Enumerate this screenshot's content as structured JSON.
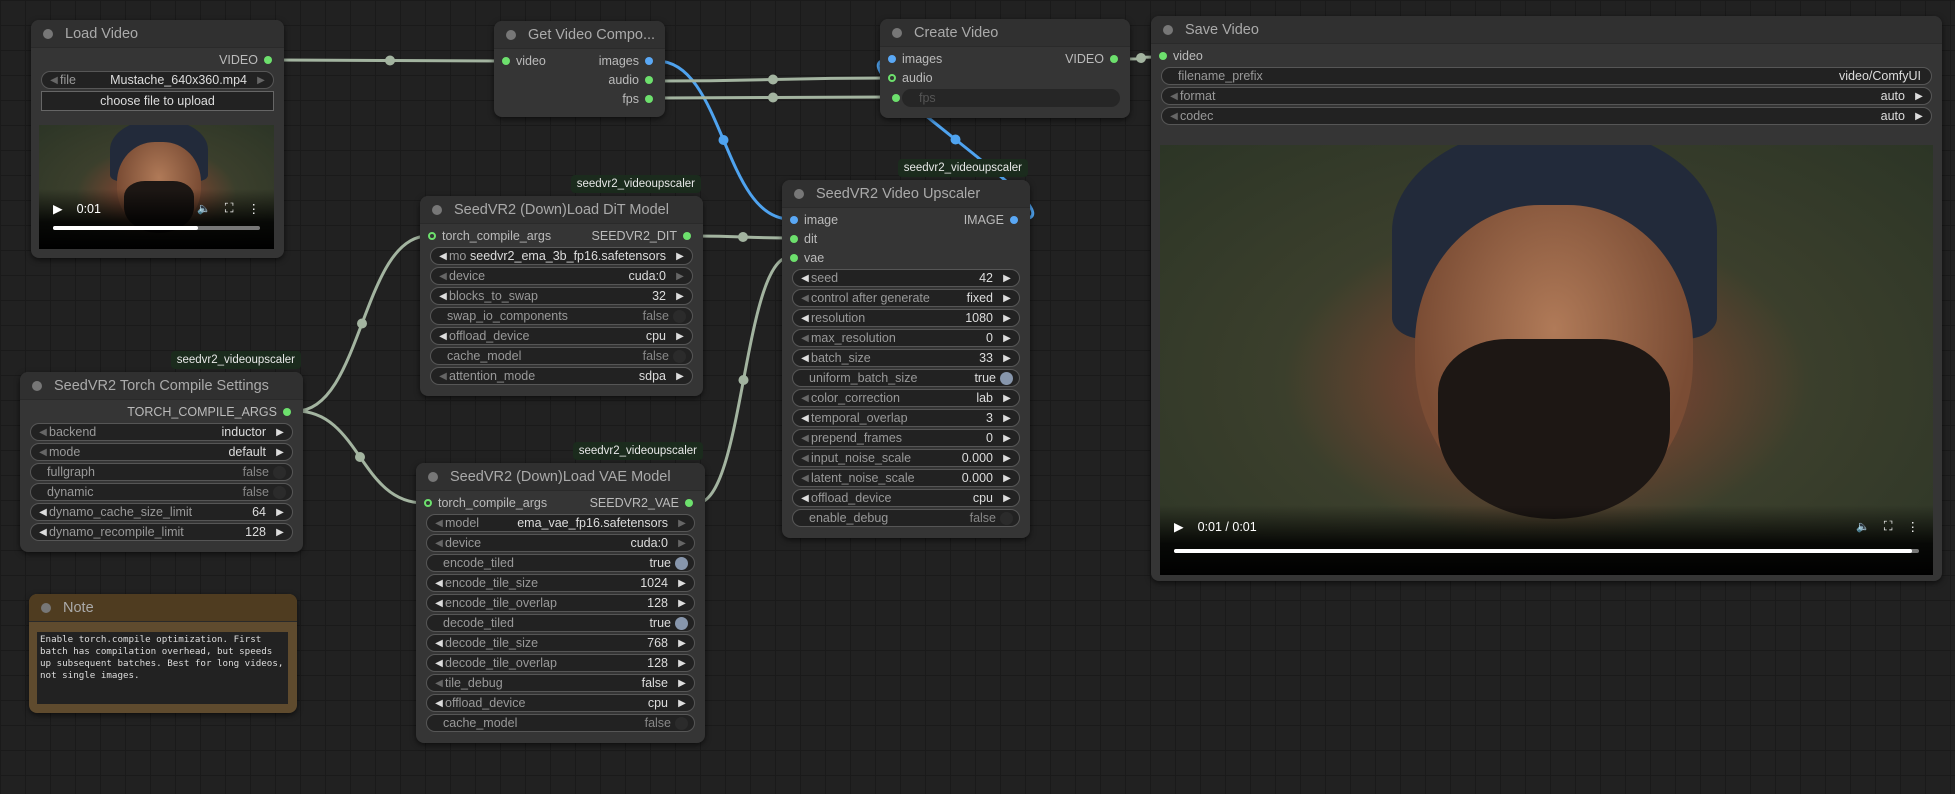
{
  "colors": {
    "video_link": "#a3b4a0",
    "image_link": "#4fa3ef",
    "slot_green": "#6de06d",
    "slot_blue": "#5aa8f5"
  },
  "nodes": [
    {
      "id": "load_video",
      "title": "Load Video",
      "outputs": [
        {
          "label": "VIDEO",
          "type": "video"
        }
      ],
      "widgets": [
        {
          "kind": "combo",
          "label": "file",
          "value": "Mustache_640x360.mp4",
          "left_dim": true,
          "right_dim": true
        },
        {
          "kind": "button",
          "label": "choose file to upload"
        }
      ],
      "preview": {
        "time": "0:01",
        "progress": 0.7
      }
    },
    {
      "id": "get_video_components",
      "title": "Get Video Compo...",
      "rows": [
        {
          "in": "video",
          "in_type": "video",
          "out": "images",
          "out_type": "image"
        },
        {
          "out": "audio",
          "out_type": "video"
        },
        {
          "out": "fps",
          "out_type": "video"
        }
      ]
    },
    {
      "id": "create_video",
      "title": "Create Video",
      "rows": [
        {
          "in": "images",
          "in_type": "image",
          "out": "VIDEO",
          "out_type": "video"
        },
        {
          "in": "audio",
          "in_type": "video",
          "hollow": true
        }
      ],
      "widgets": [
        {
          "kind": "disabled",
          "label": "fps",
          "slot": true
        }
      ]
    },
    {
      "id": "save_video",
      "title": "Save Video",
      "rows": [
        {
          "in": "video",
          "in_type": "video"
        }
      ],
      "widgets": [
        {
          "kind": "text",
          "label": "filename_prefix",
          "value": "video/ComfyUI"
        },
        {
          "kind": "combo",
          "label": "format",
          "value": "auto",
          "left_dim": true
        },
        {
          "kind": "combo",
          "label": "codec",
          "value": "auto",
          "left_dim": true
        }
      ],
      "preview": {
        "time": "0:01 / 0:01",
        "progress": 0.99
      }
    },
    {
      "id": "dit_model",
      "title": "SeedVR2 (Down)Load DiT Model",
      "badge": "seedvr2_videoupscaler",
      "rows": [
        {
          "in": "torch_compile_args",
          "in_type": "video",
          "hollow": true,
          "out": "SEEDVR2_DIT",
          "out_type": "video"
        }
      ],
      "widgets": [
        {
          "kind": "combo",
          "label": "mo ...",
          "value": "seedvr2_ema_3b_fp16.safetensors"
        },
        {
          "kind": "combo",
          "label": "device",
          "value": "cuda:0",
          "left_dim": true,
          "right_dim": true
        },
        {
          "kind": "combo",
          "label": "blocks_to_swap",
          "value": "32"
        },
        {
          "kind": "toggle",
          "label": "swap_io_components",
          "value": "false",
          "on": false
        },
        {
          "kind": "combo",
          "label": "offload_device",
          "value": "cpu"
        },
        {
          "kind": "toggle",
          "label": "cache_model",
          "value": "false",
          "on": false
        },
        {
          "kind": "combo",
          "label": "attention_mode",
          "value": "sdpa",
          "left_dim": true
        }
      ]
    },
    {
      "id": "torch_compile",
      "title": "SeedVR2 Torch Compile Settings",
      "badge": "seedvr2_videoupscaler",
      "rows": [
        {
          "out": "TORCH_COMPILE_ARGS",
          "out_type": "video"
        }
      ],
      "widgets": [
        {
          "kind": "combo",
          "label": "backend",
          "value": "inductor",
          "left_dim": true
        },
        {
          "kind": "combo",
          "label": "mode",
          "value": "default",
          "left_dim": true
        },
        {
          "kind": "toggle",
          "label": "fullgraph",
          "value": "false",
          "on": false
        },
        {
          "kind": "toggle",
          "label": "dynamic",
          "value": "false",
          "on": false
        },
        {
          "kind": "combo",
          "label": "dynamo_cache_size_limit",
          "value": "64"
        },
        {
          "kind": "combo",
          "label": "dynamo_recompile_limit",
          "value": "128"
        }
      ]
    },
    {
      "id": "note",
      "title": "Note",
      "note": "Enable torch.compile optimization. First batch has compilation overhead, but speeds up subsequent batches. Best for long videos, not single images."
    },
    {
      "id": "vae_model",
      "title": "SeedVR2 (Down)Load VAE Model",
      "badge": "seedvr2_videoupscaler",
      "rows": [
        {
          "in": "torch_compile_args",
          "in_type": "video",
          "hollow": true,
          "out": "SEEDVR2_VAE",
          "out_type": "video"
        }
      ],
      "widgets": [
        {
          "kind": "combo",
          "label": "model",
          "value": "ema_vae_fp16.safetensors",
          "left_dim": true,
          "right_dim": true
        },
        {
          "kind": "combo",
          "label": "device",
          "value": "cuda:0",
          "left_dim": true,
          "right_dim": true
        },
        {
          "kind": "toggle",
          "label": "encode_tiled",
          "value": "true",
          "on": true
        },
        {
          "kind": "combo",
          "label": "encode_tile_size",
          "value": "1024"
        },
        {
          "kind": "combo",
          "label": "encode_tile_overlap",
          "value": "128"
        },
        {
          "kind": "toggle",
          "label": "decode_tiled",
          "value": "true",
          "on": true
        },
        {
          "kind": "combo",
          "label": "decode_tile_size",
          "value": "768"
        },
        {
          "kind": "combo",
          "label": "decode_tile_overlap",
          "value": "128"
        },
        {
          "kind": "combo",
          "label": "tile_debug",
          "value": "false",
          "left_dim": true
        },
        {
          "kind": "combo",
          "label": "offload_device",
          "value": "cpu"
        },
        {
          "kind": "toggle",
          "label": "cache_model",
          "value": "false",
          "on": false
        }
      ]
    },
    {
      "id": "upscaler",
      "title": "SeedVR2 Video Upscaler",
      "badge": "seedvr2_videoupscaler",
      "rows": [
        {
          "in": "image",
          "in_type": "image",
          "out": "IMAGE",
          "out_type": "image"
        },
        {
          "in": "dit",
          "in_type": "video"
        },
        {
          "in": "vae",
          "in_type": "video"
        }
      ],
      "widgets": [
        {
          "kind": "combo",
          "label": "seed",
          "value": "42"
        },
        {
          "kind": "combo",
          "label": "control after generate",
          "value": "fixed",
          "left_dim": true
        },
        {
          "kind": "combo",
          "label": "resolution",
          "value": "1080"
        },
        {
          "kind": "combo",
          "label": "max_resolution",
          "value": "0",
          "left_dim": true
        },
        {
          "kind": "combo",
          "label": "batch_size",
          "value": "33"
        },
        {
          "kind": "toggle",
          "label": "uniform_batch_size",
          "value": "true",
          "on": true
        },
        {
          "kind": "combo",
          "label": "color_correction",
          "value": "lab",
          "left_dim": true
        },
        {
          "kind": "combo",
          "label": "temporal_overlap",
          "value": "3"
        },
        {
          "kind": "combo",
          "label": "prepend_frames",
          "value": "0",
          "left_dim": true
        },
        {
          "kind": "combo",
          "label": "input_noise_scale",
          "value": "0.000",
          "left_dim": true
        },
        {
          "kind": "combo",
          "label": "latent_noise_scale",
          "value": "0.000",
          "left_dim": true
        },
        {
          "kind": "combo",
          "label": "offload_device",
          "value": "cpu"
        },
        {
          "kind": "toggle",
          "label": "enable_debug",
          "value": "false",
          "on": false
        }
      ]
    }
  ]
}
